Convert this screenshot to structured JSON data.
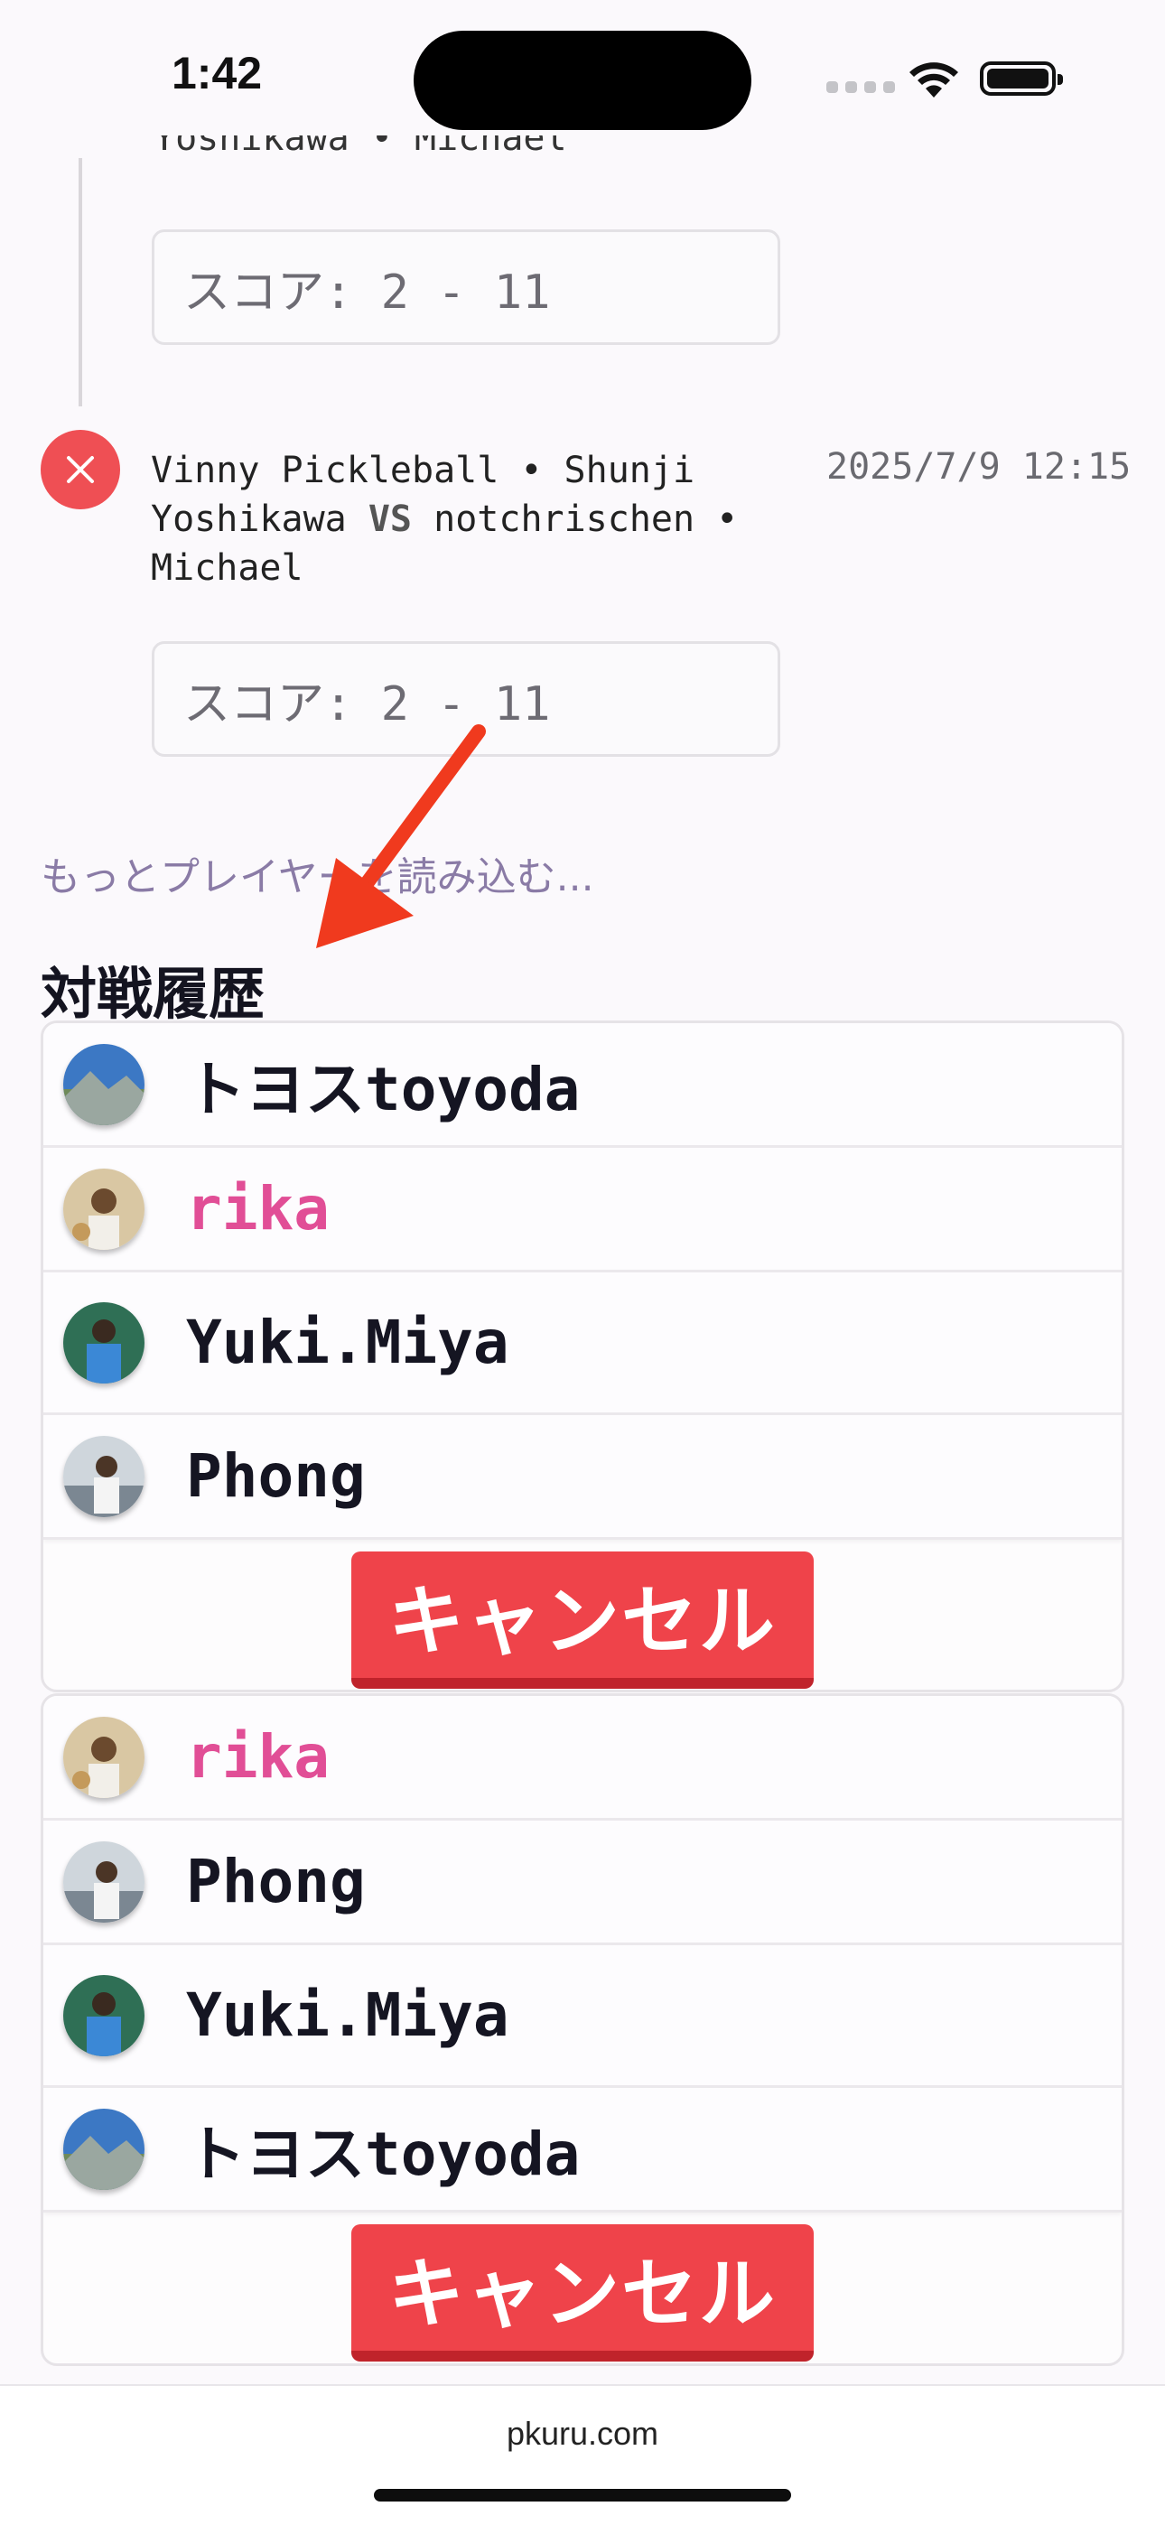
{
  "status_bar": {
    "time": "1:42"
  },
  "timeline": {
    "clipped_players": "Yoshikawa • Michael",
    "score1": "スコア: 2 - 11",
    "match": {
      "team1": "Vinny Pickleball • Shunji Yoshikawa",
      "vs": "VS",
      "team2": "notchrischen • Michael",
      "date": "2025/7/9 12:15"
    },
    "score2": "スコア: 2 - 11"
  },
  "load_more": "もっとプレイヤーを読み込む...",
  "section_title": "対戦履歴",
  "matches": [
    {
      "players": [
        {
          "name": "トヨスtoyoda",
          "highlight": false
        },
        {
          "name": "rika",
          "highlight": true
        },
        {
          "name": "Yuki.Miya",
          "highlight": false
        },
        {
          "name": "Phong",
          "highlight": false
        }
      ],
      "cancel_label": "キャンセル"
    },
    {
      "players": [
        {
          "name": "rika",
          "highlight": true
        },
        {
          "name": "Phong",
          "highlight": false
        },
        {
          "name": "Yuki.Miya",
          "highlight": false
        },
        {
          "name": "トヨスtoyoda",
          "highlight": false
        }
      ],
      "cancel_label": "キャンセル"
    }
  ],
  "footer": {
    "url": "pkuru.com"
  },
  "colors": {
    "accent_red": "#ef434a",
    "highlight_pink": "#e14e96",
    "link_purple": "#8a7ba6"
  },
  "icons": [
    "close-icon",
    "wifi-icon",
    "battery-icon",
    "cellular-signal-icon",
    "annotation-arrow-icon"
  ]
}
